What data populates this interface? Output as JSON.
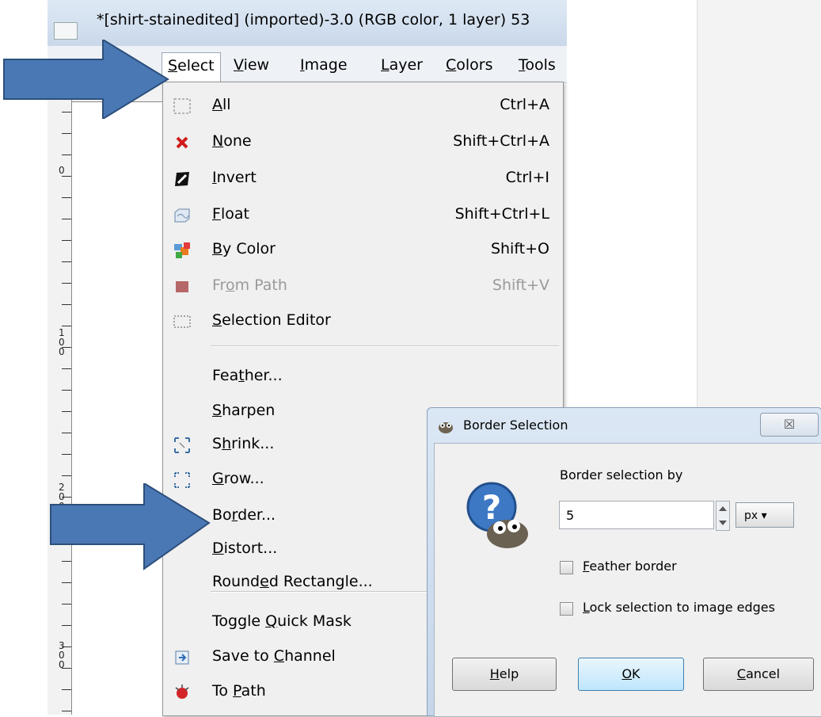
{
  "window": {
    "title": "*[shirt-stainedited] (imported)-3.0 (RGB color, 1 layer) 53"
  },
  "menubar": {
    "items": [
      {
        "label": "Select",
        "mnemonic": "S"
      },
      {
        "label": "View",
        "mnemonic": "V"
      },
      {
        "label": "Image",
        "mnemonic": "I"
      },
      {
        "label": "Layer",
        "mnemonic": "L"
      },
      {
        "label": "Colors",
        "mnemonic": "C"
      },
      {
        "label": "Tools",
        "mnemonic": "T"
      }
    ]
  },
  "ruler": {
    "labels": [
      "0",
      "1\n0\n0",
      "2\n0\n0",
      "3\n0\n0"
    ]
  },
  "select_menu": {
    "items": [
      {
        "label": "All",
        "shortcut": "Ctrl+A",
        "icon": "select-all-icon"
      },
      {
        "label": "None",
        "shortcut": "Shift+Ctrl+A",
        "icon": "select-none-icon"
      },
      {
        "label": "Invert",
        "shortcut": "Ctrl+I",
        "icon": "invert-icon"
      },
      {
        "label": "Float",
        "shortcut": "Shift+Ctrl+L",
        "icon": "float-icon"
      },
      {
        "label": "By Color",
        "shortcut": "Shift+O",
        "icon": "by-color-icon"
      },
      {
        "label": "From Path",
        "shortcut": "Shift+V",
        "icon": "from-path-icon",
        "disabled": true
      },
      {
        "label": "Selection Editor",
        "shortcut": "",
        "icon": "selection-editor-icon"
      },
      {
        "label": "Feather...",
        "shortcut": ""
      },
      {
        "label": "Sharpen",
        "shortcut": ""
      },
      {
        "label": "Shrink...",
        "shortcut": "",
        "icon": "shrink-icon"
      },
      {
        "label": "Grow...",
        "shortcut": "",
        "icon": "grow-icon"
      },
      {
        "label": "Border...",
        "shortcut": ""
      },
      {
        "label": "Distort...",
        "shortcut": ""
      },
      {
        "label": "Rounded Rectangle...",
        "shortcut": ""
      },
      {
        "label": "Toggle Quick Mask",
        "shortcut": ""
      },
      {
        "label": "Save to Channel",
        "shortcut": "",
        "icon": "save-to-channel-icon"
      },
      {
        "label": "To Path",
        "shortcut": "",
        "icon": "to-path-icon"
      }
    ]
  },
  "dialog": {
    "title": "Border Selection",
    "close_glyph": "☒",
    "prompt": "Border selection by",
    "value": "5",
    "unit": "px",
    "feather_label": "Feather border",
    "lock_label": "Lock selection to image edges",
    "help_label": "Help",
    "ok_label": "OK",
    "cancel_label": "Cancel"
  },
  "colors": {
    "arrow": "#4a78b5",
    "arrow_edge": "#2d4f7c"
  }
}
